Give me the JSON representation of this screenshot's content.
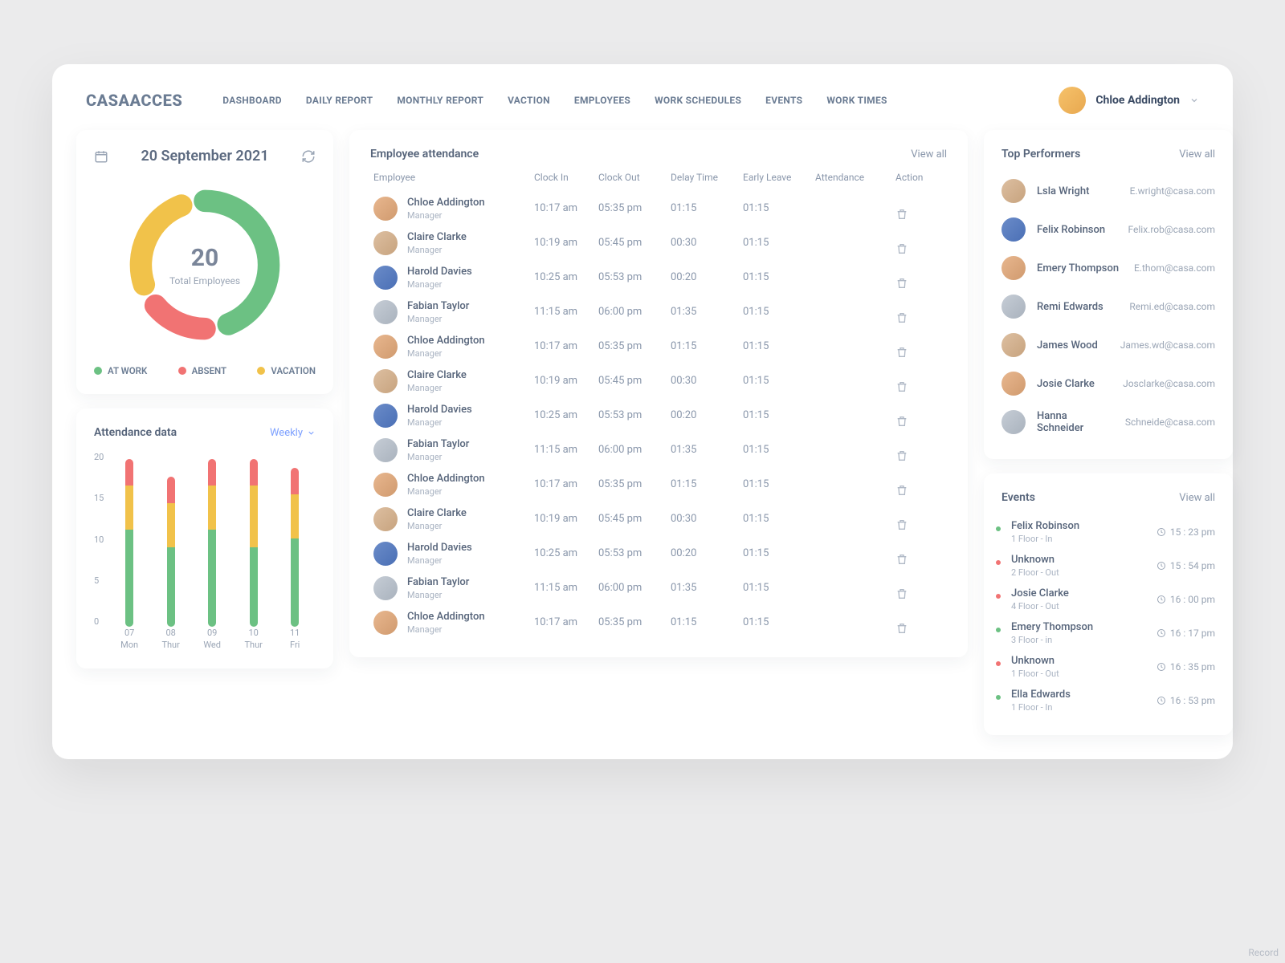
{
  "brand": "CASAACCES",
  "nav": [
    "DASHBOARD",
    "DAILY REPORT",
    "MONTHLY REPORT",
    "VACTION",
    "EMPLOYEES",
    "WORK SCHEDULES",
    "EVENTS",
    "WORK TIMES"
  ],
  "user": {
    "name": "Chloe Addington"
  },
  "colors": {
    "green": "#6cc183",
    "red": "#f17373",
    "yellow": "#f1c24a",
    "muted": "#9aa5b5"
  },
  "date_card": {
    "date": "20 September 2021",
    "total_value": "20",
    "total_label": "Total Employees",
    "legends": [
      {
        "label": "AT WORK",
        "color": "#6cc183"
      },
      {
        "label": "ABSENT",
        "color": "#f17373"
      },
      {
        "label": "VACATION",
        "color": "#f1c24a"
      }
    ]
  },
  "attendance_data": {
    "title": "Attendance data",
    "period": "Weekly",
    "y_ticks": [
      "20",
      "15",
      "10",
      "5",
      "0"
    ]
  },
  "attendance_table": {
    "title": "Employee attendance",
    "view_all": "View all",
    "columns": [
      "Employee",
      "Clock In",
      "Clock Out",
      "Delay Time",
      "Early Leave",
      "Attendance",
      "Action"
    ],
    "rows": [
      {
        "name": "Chloe Addington",
        "role": "Manager",
        "in": "10:17 am",
        "out": "05:35 pm",
        "delay": "01:15",
        "early": "01:15",
        "status": "red",
        "av": "warm"
      },
      {
        "name": "Claire Clarke",
        "role": "Manager",
        "in": "10:19 am",
        "out": "05:45 pm",
        "delay": "00:30",
        "early": "01:15",
        "status": "red",
        "av": "tan"
      },
      {
        "name": "Harold Davies",
        "role": "Manager",
        "in": "10:25 am",
        "out": "05:53 pm",
        "delay": "00:20",
        "early": "01:15",
        "status": "red",
        "av": "blue"
      },
      {
        "name": "Fabian Taylor",
        "role": "Manager",
        "in": "11:15 am",
        "out": "06:00 pm",
        "delay": "01:35",
        "early": "01:15",
        "status": "red",
        "av": "grey"
      },
      {
        "name": "Chloe Addington",
        "role": "Manager",
        "in": "10:17 am",
        "out": "05:35 pm",
        "delay": "01:15",
        "early": "01:15",
        "status": "red",
        "av": "warm"
      },
      {
        "name": "Claire Clarke",
        "role": "Manager",
        "in": "10:19 am",
        "out": "05:45 pm",
        "delay": "00:30",
        "early": "01:15",
        "status": "red",
        "av": "tan"
      },
      {
        "name": "Harold Davies",
        "role": "Manager",
        "in": "10:25 am",
        "out": "05:53 pm",
        "delay": "00:20",
        "early": "01:15",
        "status": "red",
        "av": "blue"
      },
      {
        "name": "Fabian Taylor",
        "role": "Manager",
        "in": "11:15 am",
        "out": "06:00 pm",
        "delay": "01:35",
        "early": "01:15",
        "status": "yellow",
        "av": "grey"
      },
      {
        "name": "Chloe Addington",
        "role": "Manager",
        "in": "10:17 am",
        "out": "05:35 pm",
        "delay": "01:15",
        "early": "01:15",
        "status": "yellow",
        "av": "warm"
      },
      {
        "name": "Claire Clarke",
        "role": "Manager",
        "in": "10:19 am",
        "out": "05:45 pm",
        "delay": "00:30",
        "early": "01:15",
        "status": "yellow",
        "av": "tan"
      },
      {
        "name": "Harold Davies",
        "role": "Manager",
        "in": "10:25 am",
        "out": "05:53 pm",
        "delay": "00:20",
        "early": "01:15",
        "status": "green",
        "av": "blue"
      },
      {
        "name": "Fabian Taylor",
        "role": "Manager",
        "in": "11:15 am",
        "out": "06:00 pm",
        "delay": "01:35",
        "early": "01:15",
        "status": "green",
        "av": "grey"
      },
      {
        "name": "Chloe Addington",
        "role": "Manager",
        "in": "10:17 am",
        "out": "05:35 pm",
        "delay": "01:15",
        "early": "01:15",
        "status": "green",
        "av": "warm"
      }
    ]
  },
  "top_performers": {
    "title": "Top Performers",
    "view_all": "View all",
    "rows": [
      {
        "name": "Lsla Wright",
        "email": "E.wright@casa.com",
        "av": "tan"
      },
      {
        "name": "Felix Robinson",
        "email": "Felix.rob@casa.com",
        "av": "blue"
      },
      {
        "name": "Emery Thompson",
        "email": "E.thom@casa.com",
        "av": "warm"
      },
      {
        "name": "Remi Edwards",
        "email": "Remi.ed@casa.com",
        "av": "grey"
      },
      {
        "name": "James Wood",
        "email": "James.wd@casa.com",
        "av": "tan"
      },
      {
        "name": "Josie Clarke",
        "email": "Josclarke@casa.com",
        "av": "warm"
      },
      {
        "name": "Hanna Schneider",
        "email": "Schneide@casa.com",
        "av": "grey"
      }
    ]
  },
  "events": {
    "title": "Events",
    "view_all": "View all",
    "rows": [
      {
        "name": "Felix Robinson",
        "sub": "1 Floor - In",
        "time": "15 : 23 pm",
        "status": "green",
        "av": "blue"
      },
      {
        "name": "Unknown",
        "sub": "2 Floor - Out",
        "time": "15 : 54 pm",
        "status": "red",
        "av": "grey"
      },
      {
        "name": "Josie Clarke",
        "sub": "4 Floor - Out",
        "time": "16 : 00 pm",
        "status": "red",
        "av": "warm"
      },
      {
        "name": "Emery Thompson",
        "sub": "3 Floor - in",
        "time": "16 : 17 pm",
        "status": "green",
        "av": "tan"
      },
      {
        "name": "Unknown",
        "sub": "1 Floor - Out",
        "time": "16 : 35 pm",
        "status": "red",
        "av": "grey"
      },
      {
        "name": "Ella Edwards",
        "sub": "1 Floor - In",
        "time": "16 : 53 pm",
        "status": "green",
        "av": "warm"
      }
    ]
  },
  "chart_data": [
    {
      "type": "pie",
      "title": "Total Employees",
      "total": 20,
      "series": [
        {
          "name": "AT WORK",
          "value": 10,
          "color": "#6cc183"
        },
        {
          "name": "ABSENT",
          "value": 4,
          "color": "#f17373"
        },
        {
          "name": "VACATION",
          "value": 6,
          "color": "#f1c24a"
        }
      ]
    },
    {
      "type": "bar",
      "title": "Attendance data",
      "ylabel": "",
      "ylim": [
        0,
        20
      ],
      "categories": [
        "07 Mon",
        "08 Thur",
        "09 Wed",
        "10 Thur",
        "11 Fri"
      ],
      "stacked": true,
      "series": [
        {
          "name": "AT WORK",
          "color": "#6cc183",
          "values": [
            11,
            9,
            11,
            9,
            10
          ]
        },
        {
          "name": "VACATION",
          "color": "#f1c24a",
          "values": [
            5,
            5,
            5,
            7,
            5
          ]
        },
        {
          "name": "ABSENT",
          "color": "#f17373",
          "values": [
            3,
            3,
            3,
            3,
            3
          ]
        }
      ]
    }
  ],
  "footer_hint": "Record"
}
